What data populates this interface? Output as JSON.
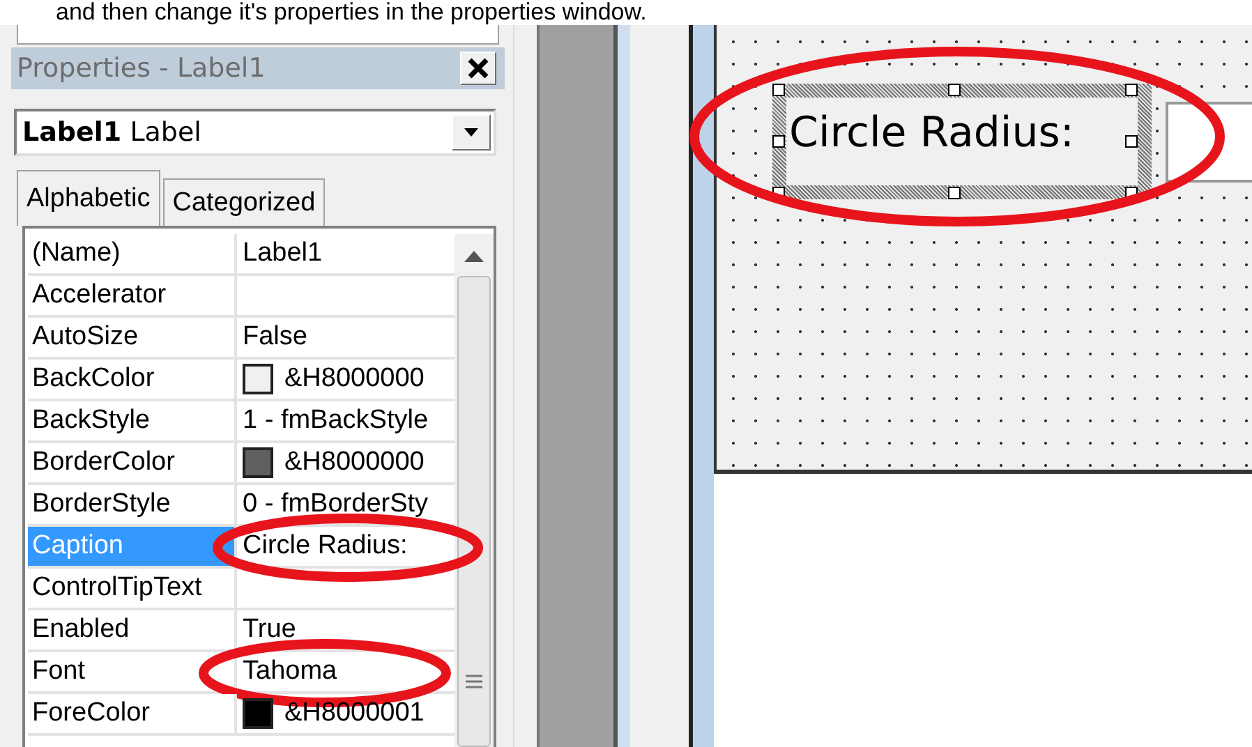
{
  "caption": "and then change it's properties in the properties window.",
  "properties_window": {
    "title": "Properties - Label1",
    "object_selector": "**Label1** Label",
    "tabs": [
      {
        "label": "Alphabetic",
        "selected": true
      },
      {
        "label": "Categorized",
        "selected": false
      }
    ],
    "rows": [
      {
        "name": "(Name)",
        "value": "Label1",
        "selected": false,
        "circled": false
      },
      {
        "name": "Accelerator",
        "value": "",
        "selected": false,
        "circled": false
      },
      {
        "name": "AutoSize",
        "value": "False",
        "selected": false,
        "circled": false
      },
      {
        "name": "BackColor",
        "value": "&H8000000",
        "color": "#f0f0f0",
        "selected": false,
        "circled": false
      },
      {
        "name": "BackStyle",
        "value": "1 - fmBackStyle",
        "selected": false,
        "circled": false
      },
      {
        "name": "BorderColor",
        "value": "&H8000000",
        "color": "#606060",
        "selected": false,
        "circled": false
      },
      {
        "name": "BorderStyle",
        "value": "0 - fmBorderSty",
        "selected": false,
        "circled": false
      },
      {
        "name": "Caption",
        "value": "Circle Radius:",
        "selected": true,
        "circled": true
      },
      {
        "name": "ControlTipText",
        "value": "",
        "selected": false,
        "circled": false
      },
      {
        "name": "Enabled",
        "value": "True",
        "selected": false,
        "circled": false
      },
      {
        "name": "Font",
        "value": "Tahoma",
        "selected": false,
        "circled": true
      },
      {
        "name": "ForeColor",
        "value": "&H8000001",
        "color": "#000000",
        "selected": false,
        "circled": false
      }
    ]
  },
  "form_designer": {
    "label": {
      "text": "Circle Radius:",
      "selected": true,
      "circled": true
    }
  }
}
